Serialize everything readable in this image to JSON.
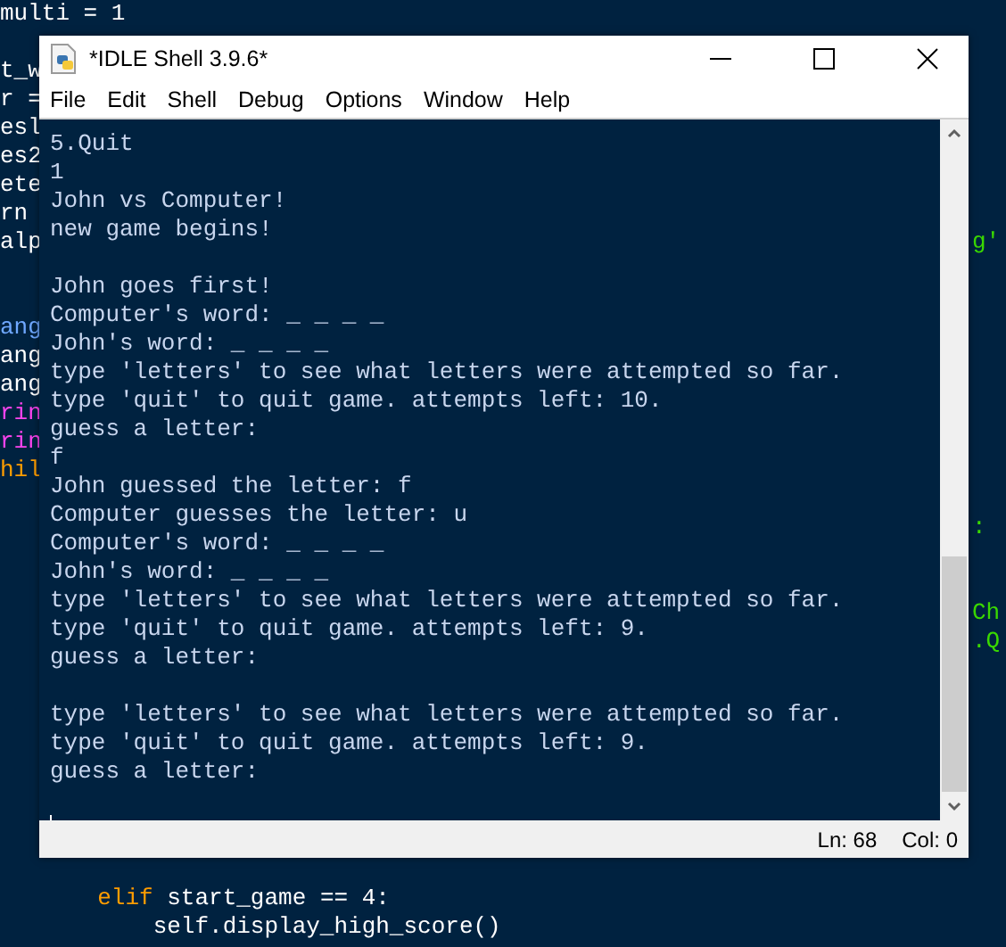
{
  "editor": {
    "left_groups": [
      [
        [
          {
            "text": "multi = 1",
            "color": "#ffffff"
          }
        ]
      ],
      [
        [
          {
            "text": "t_w",
            "color": "#ffffff"
          }
        ],
        [
          {
            "text": "r =",
            "color": "#ffffff"
          }
        ],
        [
          {
            "text": "esl",
            "color": "#ffffff"
          }
        ],
        [
          {
            "text": "es2",
            "color": "#ffffff"
          }
        ],
        [
          {
            "text": "ete",
            "color": "#ffffff"
          }
        ],
        [
          {
            "text": "rn",
            "color": "#ffffff"
          }
        ],
        [
          {
            "text": "alp",
            "color": "#ffffff"
          }
        ]
      ],
      [
        [
          {
            "text": "ang",
            "color": "#6fa8ff"
          }
        ],
        [
          {
            "text": "ang",
            "color": "#ffffff"
          }
        ],
        [
          {
            "text": "ang",
            "color": "#ffffff"
          }
        ],
        [
          {
            "text": "rin",
            "color": "#ff44f0"
          }
        ],
        [
          {
            "text": "rin",
            "color": "#ff44f0"
          }
        ],
        [
          {
            "text": "hil",
            "color": "#ff9d00"
          }
        ]
      ],
      [
        [
          {
            "text": "       elif",
            "color": "#ff9d00"
          },
          {
            "text": " start_game == 4:",
            "color": "#ffffff"
          }
        ],
        [
          {
            "text": "           self.display_high_score()",
            "color": "#ffffff"
          }
        ]
      ]
    ],
    "right_groups": [
      [
        [
          {
            "text": "g'",
            "color": "#3ad900"
          }
        ]
      ],
      [
        [
          {
            "text": ":",
            "color": "#3ad900"
          }
        ]
      ],
      [
        [
          {
            "text": "Ch",
            "color": "#3ad900"
          }
        ],
        [
          {
            "text": ".Q",
            "color": "#3ad900"
          }
        ]
      ]
    ]
  },
  "window": {
    "title": "*IDLE Shell 3.9.6*",
    "menu": [
      "File",
      "Edit",
      "Shell",
      "Debug",
      "Options",
      "Window",
      "Help"
    ],
    "shell": {
      "blocks": [
        [
          "5.Quit",
          "1",
          "John vs Computer!",
          "new game begins!"
        ],
        [
          "John goes first!",
          "Computer's word: _ _ _ _",
          "John's word: _ _ _ _",
          "type 'letters' to see what letters were attempted so far.",
          "type 'quit' to quit game. attempts left: 10.",
          "guess a letter:",
          "f",
          "John guessed the letter: f",
          "Computer guesses the letter: u",
          "Computer's word: _ _ _ _",
          "John's word: _ _ _ _",
          "type 'letters' to see what letters were attempted so far.",
          "type 'quit' to quit game. attempts left: 9.",
          "guess a letter:"
        ],
        [
          "type 'letters' to see what letters were attempted so far.",
          "type 'quit' to quit game. attempts left: 9.",
          "guess a letter:"
        ]
      ]
    },
    "status_bar": {
      "line": "Ln: 68",
      "column": "Col: 0"
    }
  }
}
